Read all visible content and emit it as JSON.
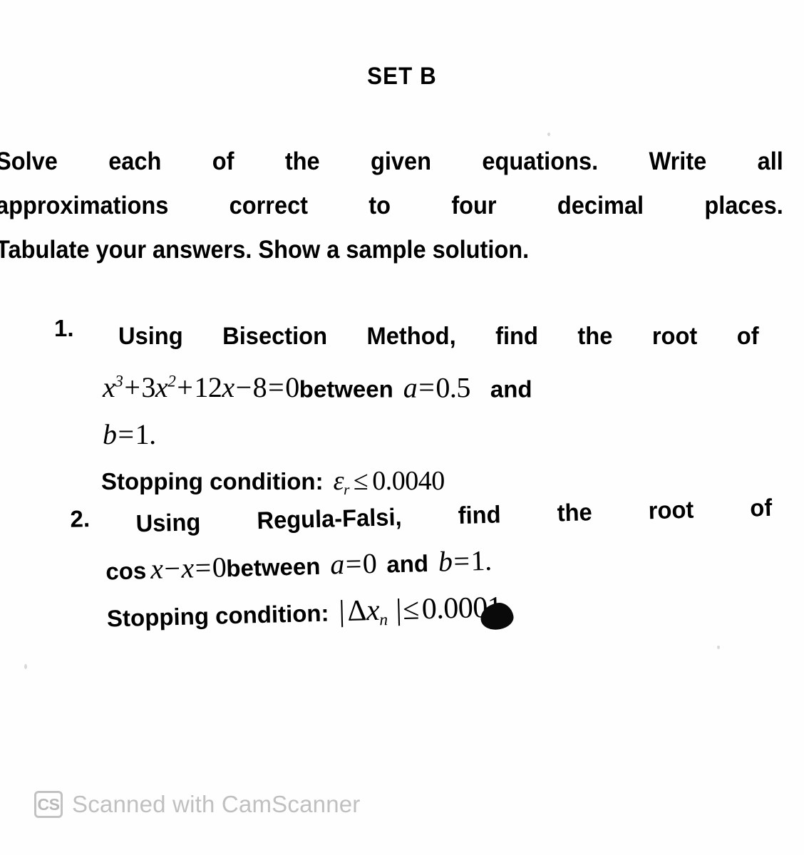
{
  "document": {
    "title": "SET B",
    "watermark": {
      "badge": "CS",
      "text": "Scanned with CamScanner"
    }
  },
  "intro": {
    "line1": [
      "Solve",
      "each",
      "of",
      "the",
      "given",
      "equations.",
      "Write",
      "all"
    ],
    "line2": [
      "approximations",
      "correct",
      "to",
      "four",
      "decimal",
      "places."
    ],
    "line3": "Tabulate your answers. Show a sample solution."
  },
  "items": [
    {
      "number": "1.",
      "heading_words": [
        "Using",
        "Bisection",
        "Method,",
        "find",
        "the",
        "root",
        "of"
      ],
      "equation": {
        "lhs_x_cubed": "x",
        "exp3": "3",
        "plus1": "+",
        "coef3": "3",
        "var_x2": "x",
        "exp2": "2",
        "plus2": "+",
        "coef12": "12",
        "var_x": "x",
        "minus": "−",
        "const8": "8",
        "equals": "=",
        "zero": "0",
        "full": "x³ + 3x² + 12x − 8 = 0"
      },
      "between_label": "between",
      "bound_a": {
        "name": "a",
        "eq": "=",
        "value": "0.5"
      },
      "and_label": "and",
      "bound_b": {
        "name": "b",
        "eq": "=",
        "value": "1",
        "period": "."
      },
      "stopping": {
        "label": "Stopping condition:",
        "symbol": "ε",
        "subscript": "r",
        "relation": "≤",
        "value": "0.0040"
      }
    },
    {
      "number": "2.",
      "heading_words": [
        "Using",
        "Regula-Falsi,",
        "find",
        "the",
        "root",
        "of"
      ],
      "equation": {
        "fn": "cos",
        "var_x": "x",
        "minus": "−",
        "var_x2": "x",
        "equals": "=",
        "zero": "0",
        "full": "cos x − x = 0"
      },
      "between_label": "between",
      "bound_a": {
        "name": "a",
        "eq": "=",
        "value": "0"
      },
      "and_label": "and",
      "bound_b": {
        "name": "b",
        "eq": "=",
        "value": "1",
        "period": "."
      },
      "stopping": {
        "label": "Stopping condition:",
        "bar_open": "|",
        "delta": "Δ",
        "symbol": "x",
        "subscript": "n",
        "bar_close": "|",
        "relation": "≤",
        "value": "0.0001"
      }
    }
  ],
  "colors": {
    "ink": "#000000",
    "paper": "#ffffff",
    "watermark_gray": "#c0c0c0"
  }
}
